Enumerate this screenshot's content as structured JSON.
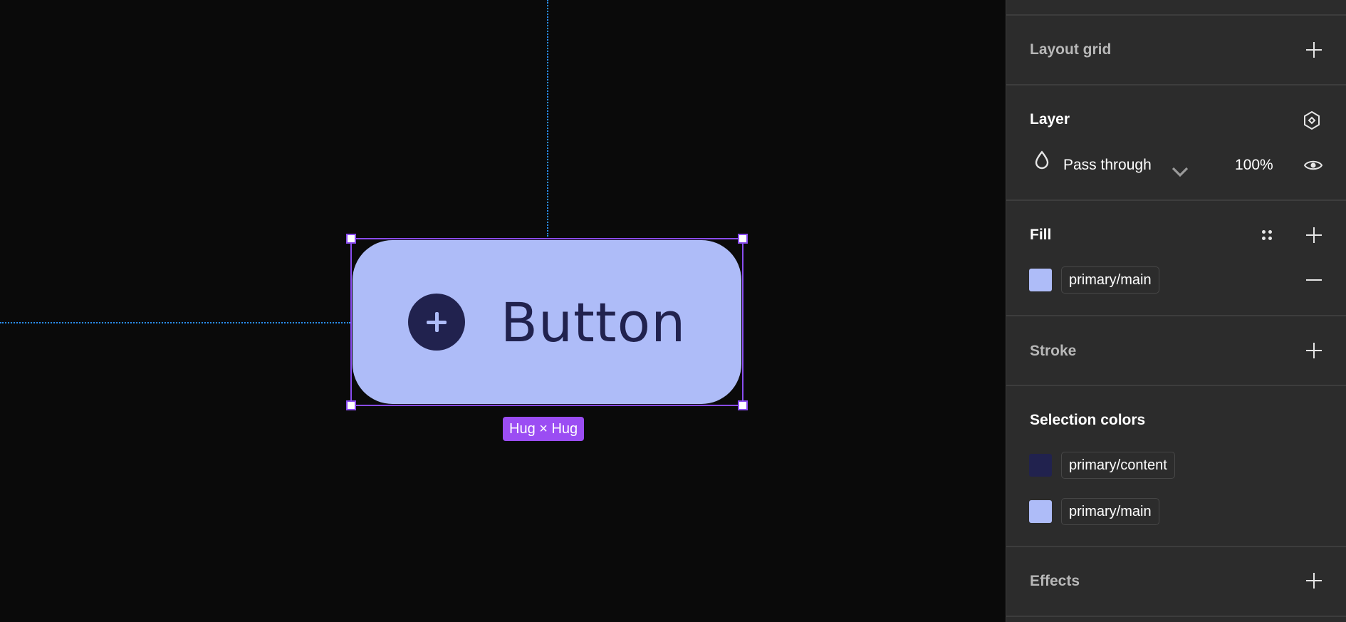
{
  "canvas": {
    "button": {
      "label": "Button"
    },
    "size_badge": "Hug × Hug"
  },
  "panel": {
    "layout_grid": {
      "title": "Layout grid"
    },
    "layer": {
      "title": "Layer",
      "blend_mode": "Pass through",
      "opacity": "100%"
    },
    "fill": {
      "title": "Fill",
      "items": [
        {
          "name": "primary/main",
          "color": "#aebcf8"
        }
      ]
    },
    "stroke": {
      "title": "Stroke"
    },
    "selection_colors": {
      "title": "Selection colors",
      "items": [
        {
          "name": "primary/content",
          "color": "#21224e"
        },
        {
          "name": "primary/main",
          "color": "#aebcf8"
        }
      ]
    },
    "effects": {
      "title": "Effects"
    }
  },
  "icons": [
    "plus-icon",
    "component-icon",
    "drop-icon",
    "chevron-down-icon",
    "eye-icon",
    "styles-grid-icon",
    "minus-icon"
  ],
  "colors": {
    "canvas_bg": "#0a0a0a",
    "panel_bg": "#2c2c2c",
    "selection": "#8a4cf0",
    "guide": "#2a8ff0",
    "badge": "#9b4df3"
  }
}
